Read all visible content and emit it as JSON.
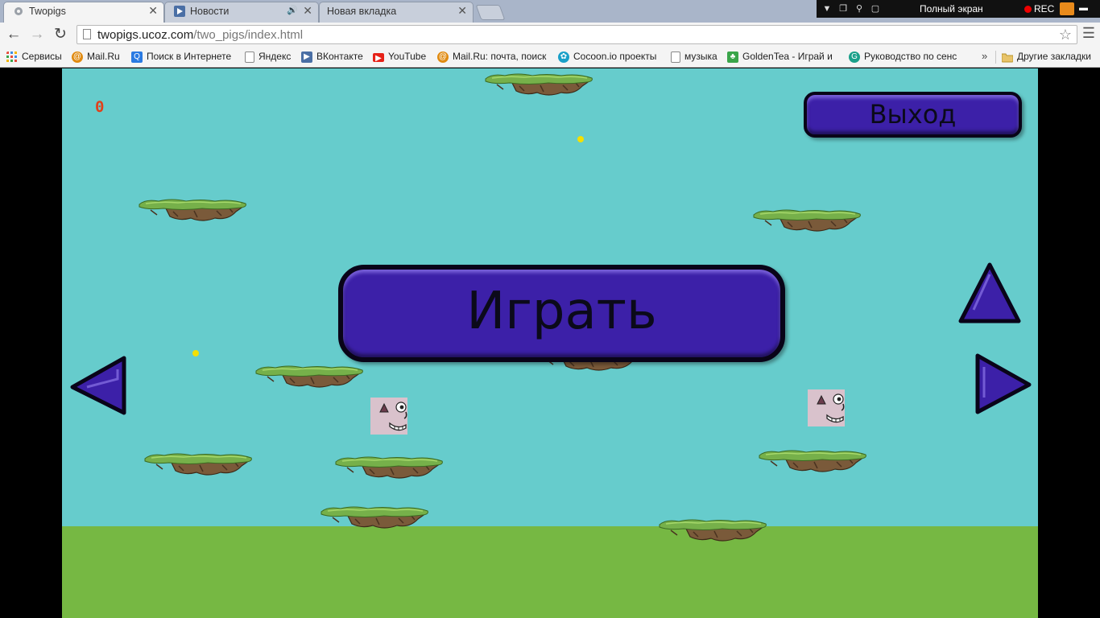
{
  "browser": {
    "tabs": [
      {
        "title": "Twopigs",
        "active": true
      },
      {
        "title": "Новости",
        "active": false,
        "audio": true
      },
      {
        "title": "Новая вкладка",
        "active": false
      }
    ],
    "system_bar": {
      "fullscreen_label": "Полный экран",
      "rec_label": "REC"
    },
    "address": {
      "host": "twopigs.ucoz.com",
      "path": "/two_pigs/index.html"
    },
    "bookmarks": [
      {
        "label": "Сервисы",
        "icon": "apps-grid-icon",
        "color": "#e54b3c"
      },
      {
        "label": "Mail.Ru",
        "icon": "mailru-icon",
        "color": "#e08a10"
      },
      {
        "label": "Поиск в Интернете",
        "icon": "search-q-icon",
        "color": "#2a7ae2"
      },
      {
        "label": "Яндекс",
        "icon": "page-icon",
        "color": "#ffffff"
      },
      {
        "label": "ВКонтакте",
        "icon": "vk-icon",
        "color": "#4a6fa5"
      },
      {
        "label": "YouTube",
        "icon": "youtube-icon",
        "color": "#e62117"
      },
      {
        "label": "Mail.Ru: почта, поиск",
        "icon": "mailru-icon",
        "color": "#e08a10"
      },
      {
        "label": "Cocoon.io проекты",
        "icon": "cocoon-icon",
        "color": "#1aa0c8"
      },
      {
        "label": "музыка",
        "icon": "page-icon",
        "color": "#ffffff"
      },
      {
        "label": "GoldenTea - Играй и",
        "icon": "goldentea-icon",
        "color": "#3aa54a"
      },
      {
        "label": "Руководство по сенс",
        "icon": "guide-icon",
        "color": "#1aa08a"
      }
    ],
    "other_bookmarks": "Другие закладки",
    "more_symbol": "»"
  },
  "game": {
    "score": "0",
    "exit_label": "Выход",
    "play_label": "Играть",
    "colors": {
      "sky": "#66cccc",
      "ground": "#76b843",
      "button": "#3c20a8",
      "score": "#e0401a",
      "coin": "#f5e000"
    }
  }
}
